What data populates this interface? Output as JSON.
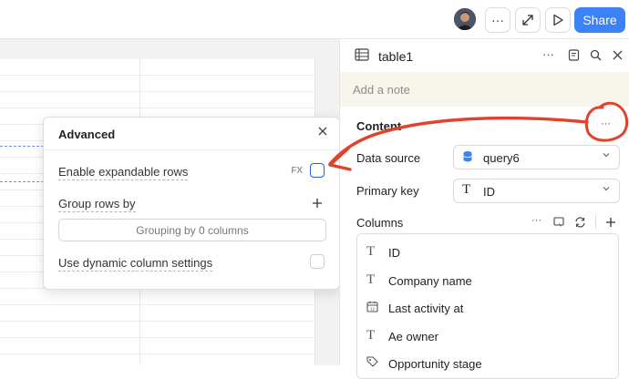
{
  "topbar": {
    "more_label": "···",
    "share_label": "Share"
  },
  "popover": {
    "title": "Advanced",
    "rows": {
      "expandable": "Enable expandable rows",
      "expandable_fx": "FX",
      "group_by": "Group rows by",
      "grouping_button": "Grouping by 0 columns",
      "dynamic": "Use dynamic column settings"
    }
  },
  "panel": {
    "component_name": "table1",
    "header_more": "···",
    "note_placeholder": "Add a note",
    "content_label": "Content",
    "content_more": "···",
    "data_source_label": "Data source",
    "data_source_value": "query6",
    "primary_key_label": "Primary key",
    "primary_key_value": "ID",
    "columns_label": "Columns",
    "columns_more": "···",
    "columns": [
      {
        "icon": "text-type-icon",
        "name": "ID"
      },
      {
        "icon": "text-type-icon",
        "name": "Company name"
      },
      {
        "icon": "calendar-type-icon",
        "name": "Last activity at"
      },
      {
        "icon": "text-type-icon",
        "name": "Ae owner"
      },
      {
        "icon": "tag-type-icon",
        "name": "Opportunity stage"
      }
    ]
  },
  "annotation": {
    "color": "#e0432b"
  },
  "colors": {
    "accent": "#3b82f6",
    "note_bg": "#f8f6ec"
  }
}
